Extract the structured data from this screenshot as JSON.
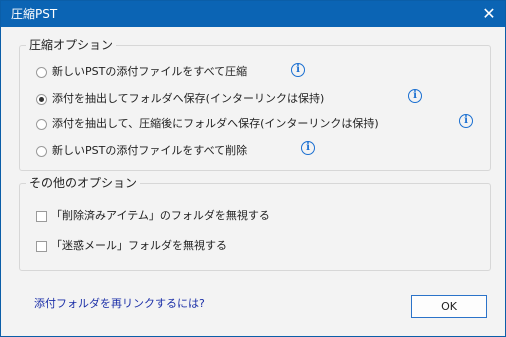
{
  "window": {
    "title": "圧縮PST",
    "close_glyph": "✕"
  },
  "compress_options": {
    "legend": "圧縮オプション",
    "options": [
      {
        "label": "新しいPSTの添付ファイルをすべて圧縮",
        "selected": false
      },
      {
        "label": "添付を抽出してフォルダへ保存(インターリンクは保持)",
        "selected": true
      },
      {
        "label": "添付を抽出して、圧縮後にフォルダへ保存(インターリンクは保持)",
        "selected": false
      },
      {
        "label": "新しいPSTの添付ファイルをすべて削除",
        "selected": false
      }
    ],
    "info_glyph": "i"
  },
  "other_options": {
    "legend": "その他のオプション",
    "checkboxes": [
      {
        "label": "「削除済みアイテム」のフォルダを無視する",
        "checked": false
      },
      {
        "label": "「迷惑メール」フォルダを無視する",
        "checked": false
      }
    ]
  },
  "footer": {
    "help_link": "添付フォルダを再リンクするには?",
    "ok_label": "OK"
  },
  "colors": {
    "titlebar": "#0b64b4",
    "info_icon": "#1a6fd1",
    "link": "#1b2fa8"
  }
}
